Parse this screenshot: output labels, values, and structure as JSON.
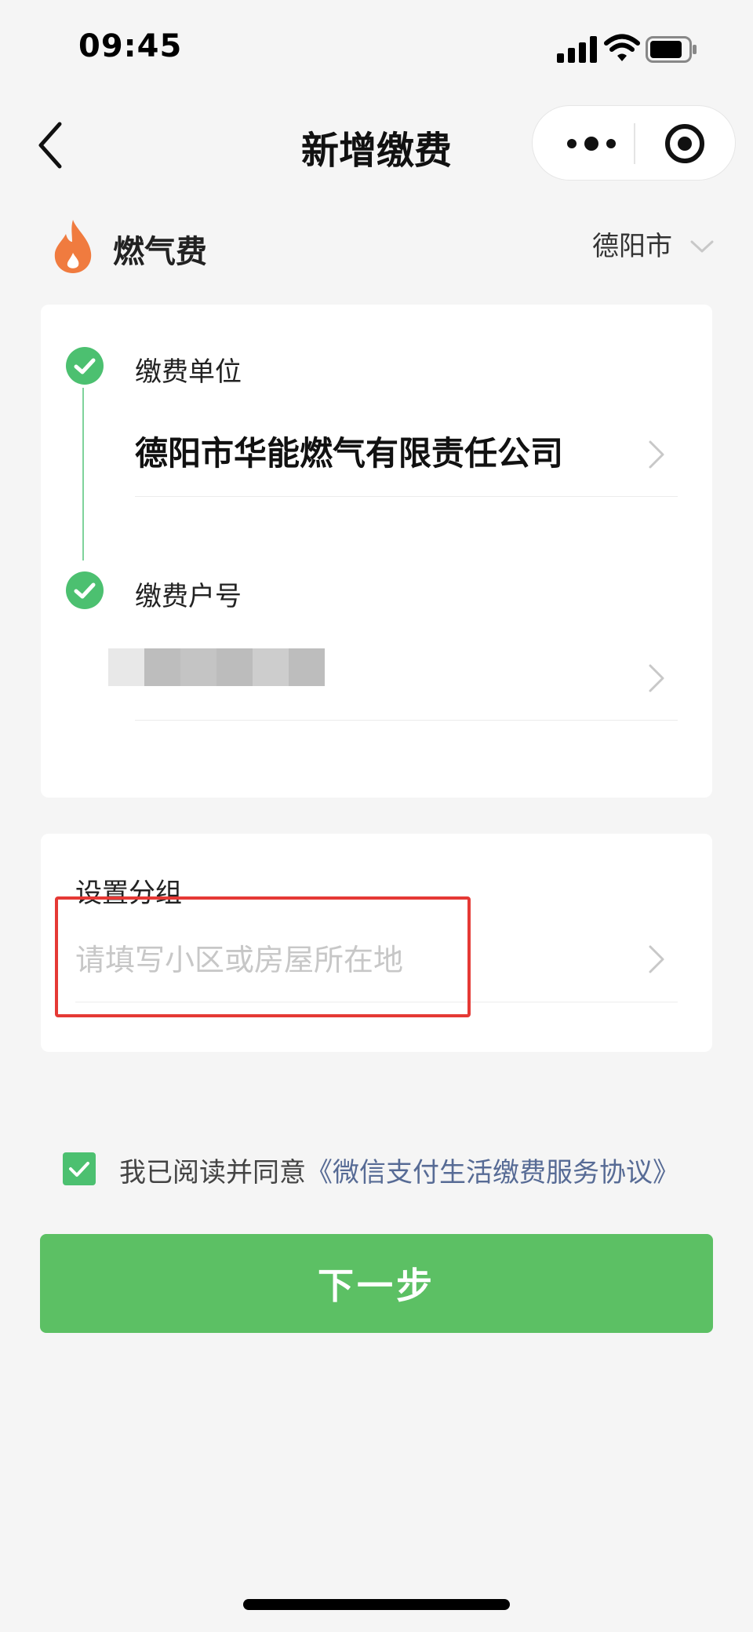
{
  "status_bar": {
    "time": "09:45"
  },
  "header": {
    "title": "新增缴费"
  },
  "category": {
    "label": "燃气费",
    "city": "德阳市"
  },
  "payment_unit": {
    "label": "缴费单位",
    "value": "德阳市华能燃气有限责任公司"
  },
  "account_number": {
    "label": "缴费户号"
  },
  "group": {
    "label": "设置分组",
    "placeholder": "请填写小区或房屋所在地"
  },
  "agreement": {
    "prefix": "我已阅读并同意",
    "link": "《微信支付生活缴费服务协议》",
    "checked": true
  },
  "next_button": {
    "label": "下一步"
  },
  "colors": {
    "accent": "#5cc064",
    "check": "#4cc070",
    "link": "#576b95",
    "flame": "#f07b3f",
    "highlight": "#e53935"
  }
}
